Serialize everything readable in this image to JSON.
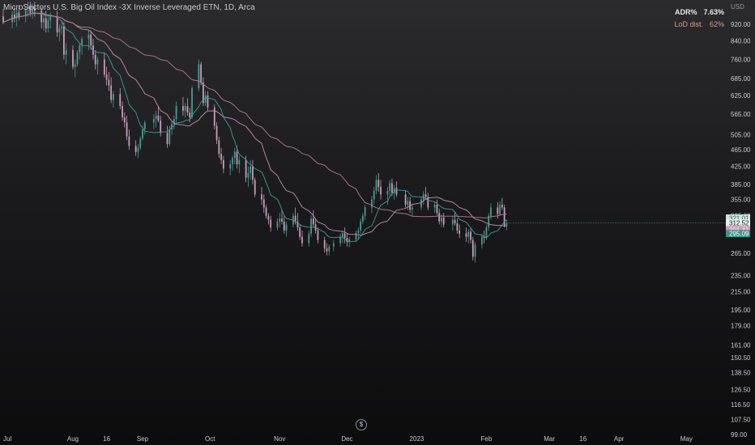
{
  "header": {
    "title": "MicroSectors U.S. Big Oil Index -3X Inverse Leveraged ETN",
    "interval": "1D",
    "exchange": "Arca",
    "currency": "USD"
  },
  "stats": {
    "adr_label": "ADR%",
    "adr_value": "7.63%",
    "lod_label": "LoD dist.",
    "lod_value": "62%"
  },
  "price_tags": {
    "tag1": "321.01",
    "last_price": "312.52",
    "countdown": "09:34:31",
    "tag3": "301.41",
    "tag4": "295.09"
  },
  "colors": {
    "up": "#4a9a8c",
    "down": "#c79cb6",
    "ma_fast": "#3b9f93",
    "ma_mid": "#c58fae",
    "ma_slow": "#b57c8e"
  },
  "event_icon": "dollar-icon",
  "chart_data": {
    "type": "candlestick",
    "scale": "log",
    "ylim": [
      99,
      1050
    ],
    "y_ticks": [
      "920.00",
      "840.00",
      "760.00",
      "685.00",
      "625.00",
      "565.00",
      "505.00",
      "465.00",
      "425.00",
      "385.00",
      "355.00",
      "325.00",
      "295.00",
      "265.00",
      "235.00",
      "215.00",
      "195.00",
      "179.00",
      "161.00",
      "150.50",
      "138.50",
      "126.50",
      "116.50",
      "107.50",
      "99.00"
    ],
    "x_ticks": [
      "Jul",
      "Aug",
      "16",
      "Sep",
      "Oct",
      "Nov",
      "Dec",
      "2023",
      "Feb",
      "Mar",
      "16",
      "Apr",
      "May"
    ],
    "x_tick_dates": [
      "2022-07-01",
      "2022-08-01",
      "2022-08-16",
      "2022-09-01",
      "2022-10-01",
      "2022-11-01",
      "2022-12-01",
      "2023-01-01",
      "2023-02-01",
      "2023-03-01",
      "2023-03-16",
      "2023-04-01",
      "2023-05-01"
    ],
    "ohlc": [
      [
        "2022-07-01",
        960,
        1000,
        920,
        930
      ],
      [
        "2022-07-05",
        930,
        990,
        900,
        970
      ],
      [
        "2022-07-06",
        970,
        1010,
        930,
        950
      ],
      [
        "2022-07-07",
        950,
        1000,
        910,
        980
      ],
      [
        "2022-07-08",
        980,
        1020,
        940,
        960
      ],
      [
        "2022-07-11",
        960,
        1010,
        930,
        1000
      ],
      [
        "2022-07-12",
        1000,
        1040,
        960,
        1010
      ],
      [
        "2022-07-13",
        1010,
        1040,
        960,
        980
      ],
      [
        "2022-07-14",
        980,
        1030,
        950,
        1010
      ],
      [
        "2022-07-15",
        1010,
        1040,
        960,
        990
      ],
      [
        "2022-07-18",
        990,
        1010,
        900,
        930
      ],
      [
        "2022-07-19",
        930,
        980,
        890,
        950
      ],
      [
        "2022-07-20",
        950,
        990,
        880,
        900
      ],
      [
        "2022-07-21",
        900,
        960,
        880,
        940
      ],
      [
        "2022-07-22",
        940,
        980,
        900,
        960
      ],
      [
        "2022-07-25",
        960,
        990,
        860,
        880
      ],
      [
        "2022-07-26",
        880,
        920,
        840,
        900
      ],
      [
        "2022-07-27",
        900,
        940,
        870,
        910
      ],
      [
        "2022-07-28",
        910,
        930,
        760,
        780
      ],
      [
        "2022-07-29",
        780,
        830,
        740,
        800
      ],
      [
        "2022-08-01",
        800,
        820,
        720,
        730
      ],
      [
        "2022-08-02",
        730,
        760,
        690,
        740
      ],
      [
        "2022-08-03",
        740,
        800,
        730,
        790
      ],
      [
        "2022-08-04",
        790,
        830,
        760,
        820
      ],
      [
        "2022-08-05",
        820,
        860,
        780,
        850
      ],
      [
        "2022-08-08",
        850,
        890,
        800,
        870
      ],
      [
        "2022-08-09",
        870,
        890,
        800,
        820
      ],
      [
        "2022-08-10",
        820,
        850,
        760,
        780
      ],
      [
        "2022-08-11",
        780,
        800,
        720,
        740
      ],
      [
        "2022-08-12",
        740,
        770,
        700,
        760
      ],
      [
        "2022-08-15",
        760,
        790,
        690,
        700
      ],
      [
        "2022-08-16",
        700,
        730,
        660,
        680
      ],
      [
        "2022-08-17",
        680,
        710,
        640,
        660
      ],
      [
        "2022-08-18",
        660,
        690,
        600,
        610
      ],
      [
        "2022-08-19",
        610,
        640,
        585,
        630
      ],
      [
        "2022-08-22",
        630,
        650,
        580,
        590
      ],
      [
        "2022-08-23",
        590,
        605,
        545,
        555
      ],
      [
        "2022-08-24",
        555,
        570,
        525,
        540
      ],
      [
        "2022-08-25",
        540,
        560,
        490,
        500
      ],
      [
        "2022-08-26",
        500,
        520,
        465,
        475
      ],
      [
        "2022-08-29",
        475,
        490,
        450,
        460
      ],
      [
        "2022-08-30",
        460,
        480,
        445,
        470
      ],
      [
        "2022-08-31",
        470,
        500,
        465,
        495
      ],
      [
        "2022-09-01",
        495,
        530,
        490,
        520
      ],
      [
        "2022-09-02",
        520,
        545,
        505,
        540
      ],
      [
        "2022-09-06",
        540,
        565,
        520,
        550
      ],
      [
        "2022-09-07",
        550,
        575,
        525,
        560
      ],
      [
        "2022-09-08",
        560,
        590,
        540,
        545
      ],
      [
        "2022-09-09",
        545,
        560,
        500,
        510
      ],
      [
        "2022-09-12",
        510,
        530,
        470,
        480
      ],
      [
        "2022-09-13",
        480,
        530,
        475,
        520
      ],
      [
        "2022-09-14",
        520,
        545,
        505,
        535
      ],
      [
        "2022-09-15",
        535,
        560,
        520,
        550
      ],
      [
        "2022-09-16",
        550,
        605,
        540,
        590
      ],
      [
        "2022-09-19",
        590,
        620,
        560,
        575
      ],
      [
        "2022-09-20",
        575,
        600,
        555,
        590
      ],
      [
        "2022-09-21",
        590,
        615,
        560,
        570
      ],
      [
        "2022-09-22",
        570,
        585,
        540,
        555
      ],
      [
        "2022-09-23",
        555,
        660,
        550,
        650
      ],
      [
        "2022-09-26",
        650,
        760,
        640,
        740
      ],
      [
        "2022-09-27",
        740,
        750,
        660,
        670
      ],
      [
        "2022-09-28",
        670,
        690,
        590,
        600
      ],
      [
        "2022-09-29",
        600,
        640,
        590,
        625
      ],
      [
        "2022-09-30",
        625,
        640,
        575,
        585
      ],
      [
        "2022-10-03",
        585,
        595,
        520,
        530
      ],
      [
        "2022-10-04",
        530,
        540,
        480,
        490
      ],
      [
        "2022-10-05",
        490,
        500,
        445,
        455
      ],
      [
        "2022-10-06",
        455,
        470,
        430,
        440
      ],
      [
        "2022-10-07",
        440,
        450,
        410,
        420
      ],
      [
        "2022-10-10",
        420,
        440,
        405,
        430
      ],
      [
        "2022-10-11",
        430,
        450,
        415,
        445
      ],
      [
        "2022-10-12",
        445,
        470,
        430,
        460
      ],
      [
        "2022-10-13",
        460,
        475,
        420,
        430
      ],
      [
        "2022-10-14",
        430,
        450,
        410,
        440
      ],
      [
        "2022-10-17",
        440,
        450,
        390,
        400
      ],
      [
        "2022-10-18",
        400,
        425,
        380,
        410
      ],
      [
        "2022-10-19",
        410,
        440,
        395,
        425
      ],
      [
        "2022-10-20",
        425,
        440,
        385,
        395
      ],
      [
        "2022-10-21",
        395,
        400,
        360,
        365
      ],
      [
        "2022-10-24",
        365,
        380,
        345,
        355
      ],
      [
        "2022-10-25",
        355,
        365,
        330,
        340
      ],
      [
        "2022-10-26",
        340,
        345,
        320,
        325
      ],
      [
        "2022-10-27",
        325,
        330,
        310,
        318
      ],
      [
        "2022-10-28",
        318,
        325,
        298,
        305
      ],
      [
        "2022-10-31",
        305,
        320,
        300,
        315
      ],
      [
        "2022-11-01",
        315,
        330,
        305,
        320
      ],
      [
        "2022-11-02",
        320,
        335,
        310,
        315
      ],
      [
        "2022-11-03",
        315,
        325,
        295,
        300
      ],
      [
        "2022-11-04",
        300,
        315,
        290,
        310
      ],
      [
        "2022-11-07",
        310,
        330,
        305,
        325
      ],
      [
        "2022-11-08",
        325,
        340,
        310,
        315
      ],
      [
        "2022-11-09",
        315,
        330,
        300,
        305
      ],
      [
        "2022-11-10",
        305,
        310,
        285,
        290
      ],
      [
        "2022-11-11",
        290,
        300,
        275,
        280
      ],
      [
        "2022-11-14",
        280,
        300,
        275,
        295
      ],
      [
        "2022-11-15",
        295,
        325,
        290,
        320
      ],
      [
        "2022-11-16",
        320,
        335,
        305,
        310
      ],
      [
        "2022-11-17",
        310,
        320,
        295,
        300
      ],
      [
        "2022-11-18",
        300,
        305,
        280,
        285
      ],
      [
        "2022-11-21",
        285,
        290,
        266,
        272
      ],
      [
        "2022-11-22",
        272,
        280,
        262,
        268
      ],
      [
        "2022-11-23",
        268,
        278,
        262,
        275
      ],
      [
        "2022-11-25",
        275,
        285,
        268,
        280
      ],
      [
        "2022-11-28",
        280,
        295,
        275,
        290
      ],
      [
        "2022-11-29",
        290,
        300,
        280,
        295
      ],
      [
        "2022-11-30",
        295,
        305,
        280,
        288
      ],
      [
        "2022-12-01",
        288,
        295,
        275,
        282
      ],
      [
        "2022-12-02",
        282,
        290,
        274,
        286
      ],
      [
        "2022-12-05",
        286,
        300,
        282,
        296
      ],
      [
        "2022-12-06",
        296,
        305,
        286,
        300
      ],
      [
        "2022-12-07",
        300,
        320,
        295,
        315
      ],
      [
        "2022-12-08",
        315,
        330,
        310,
        325
      ],
      [
        "2022-12-09",
        325,
        345,
        318,
        340
      ],
      [
        "2022-12-12",
        340,
        362,
        330,
        355
      ],
      [
        "2022-12-13",
        355,
        380,
        345,
        372
      ],
      [
        "2022-12-14",
        372,
        405,
        365,
        395
      ],
      [
        "2022-12-15",
        395,
        410,
        370,
        380
      ],
      [
        "2022-12-16",
        380,
        395,
        355,
        365
      ],
      [
        "2022-12-19",
        365,
        380,
        345,
        372
      ],
      [
        "2022-12-20",
        372,
        395,
        360,
        388
      ],
      [
        "2022-12-21",
        388,
        398,
        362,
        368
      ],
      [
        "2022-12-22",
        368,
        385,
        355,
        378
      ],
      [
        "2022-12-23",
        378,
        392,
        360,
        365
      ],
      [
        "2022-12-27",
        365,
        372,
        340,
        345
      ],
      [
        "2022-12-28",
        345,
        360,
        335,
        352
      ],
      [
        "2022-12-29",
        352,
        360,
        330,
        336
      ],
      [
        "2022-12-30",
        336,
        348,
        325,
        340
      ],
      [
        "2023-01-03",
        340,
        360,
        335,
        355
      ],
      [
        "2023-01-04",
        355,
        372,
        345,
        365
      ],
      [
        "2023-01-05",
        365,
        380,
        355,
        360
      ],
      [
        "2023-01-06",
        360,
        368,
        335,
        340
      ],
      [
        "2023-01-09",
        340,
        352,
        330,
        345
      ],
      [
        "2023-01-10",
        345,
        355,
        325,
        330
      ],
      [
        "2023-01-11",
        330,
        338,
        310,
        315
      ],
      [
        "2023-01-12",
        315,
        328,
        306,
        322
      ],
      [
        "2023-01-13",
        322,
        330,
        305,
        310
      ],
      [
        "2023-01-17",
        310,
        325,
        300,
        318
      ],
      [
        "2023-01-18",
        318,
        332,
        308,
        312
      ],
      [
        "2023-01-19",
        312,
        320,
        295,
        300
      ],
      [
        "2023-01-20",
        300,
        310,
        288,
        295
      ],
      [
        "2023-01-23",
        295,
        305,
        282,
        290
      ],
      [
        "2023-01-24",
        290,
        302,
        280,
        298
      ],
      [
        "2023-01-25",
        298,
        305,
        280,
        285
      ],
      [
        "2023-01-26",
        285,
        290,
        255,
        260
      ],
      [
        "2023-01-27",
        260,
        282,
        252,
        278
      ],
      [
        "2023-01-30",
        278,
        295,
        272,
        290
      ],
      [
        "2023-01-31",
        290,
        300,
        280,
        288
      ],
      [
        "2023-02-01",
        288,
        310,
        285,
        305
      ],
      [
        "2023-02-02",
        305,
        330,
        300,
        325
      ],
      [
        "2023-02-03",
        325,
        348,
        318,
        340
      ],
      [
        "2023-02-06",
        340,
        350,
        320,
        328
      ],
      [
        "2023-02-07",
        328,
        352,
        325,
        345
      ],
      [
        "2023-02-08",
        345,
        358,
        335,
        340
      ],
      [
        "2023-02-09",
        340,
        345,
        305,
        308
      ],
      [
        "2023-02-10",
        308,
        318,
        300,
        312.52
      ]
    ]
  }
}
